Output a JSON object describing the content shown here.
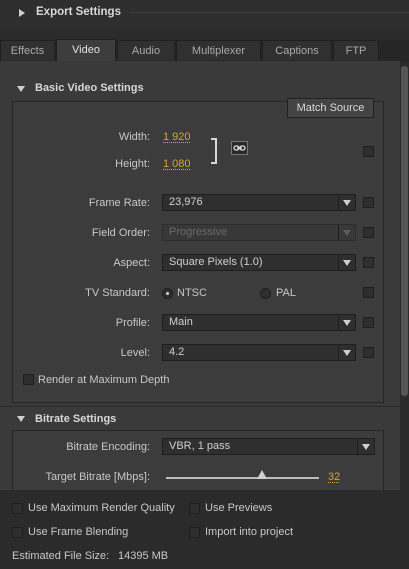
{
  "export_settings": {
    "title": "Export Settings"
  },
  "tabs": [
    {
      "label": "Effects"
    },
    {
      "label": "Video"
    },
    {
      "label": "Audio"
    },
    {
      "label": "Multiplexer"
    },
    {
      "label": "Captions"
    },
    {
      "label": "FTP"
    }
  ],
  "active_tab": "Video",
  "basic_video": {
    "title": "Basic Video Settings",
    "match_source": "Match Source",
    "width_label": "Width:",
    "width_value": "1 920",
    "height_label": "Height:",
    "height_value": "1 080",
    "frame_rate_label": "Frame Rate:",
    "frame_rate_value": "23,976",
    "field_order_label": "Field Order:",
    "field_order_value": "Progressive",
    "aspect_label": "Aspect:",
    "aspect_value": "Square Pixels (1.0)",
    "tv_standard_label": "TV Standard:",
    "ntsc_label": "NTSC",
    "pal_label": "PAL",
    "tv_standard_selected": "NTSC",
    "profile_label": "Profile:",
    "profile_value": "Main",
    "level_label": "Level:",
    "level_value": "4.2",
    "render_max_depth": "Render at Maximum Depth"
  },
  "bitrate": {
    "title": "Bitrate Settings",
    "encoding_label": "Bitrate Encoding:",
    "encoding_value": "VBR, 1 pass",
    "target_label": "Target Bitrate [Mbps]:",
    "target_value": "32",
    "target_fraction": 0.63
  },
  "footer": {
    "max_render_quality": "Use Maximum Render Quality",
    "use_previews": "Use Previews",
    "frame_blending": "Use Frame Blending",
    "import_project": "Import into project",
    "estimated_label": "Estimated File Size:",
    "estimated_value": "14395 MB"
  },
  "colors": {
    "accent": "#d6a43a",
    "panel": "#3c3c3c",
    "background": "#2b2b2b"
  },
  "icons": {
    "chain": "link-icon"
  }
}
